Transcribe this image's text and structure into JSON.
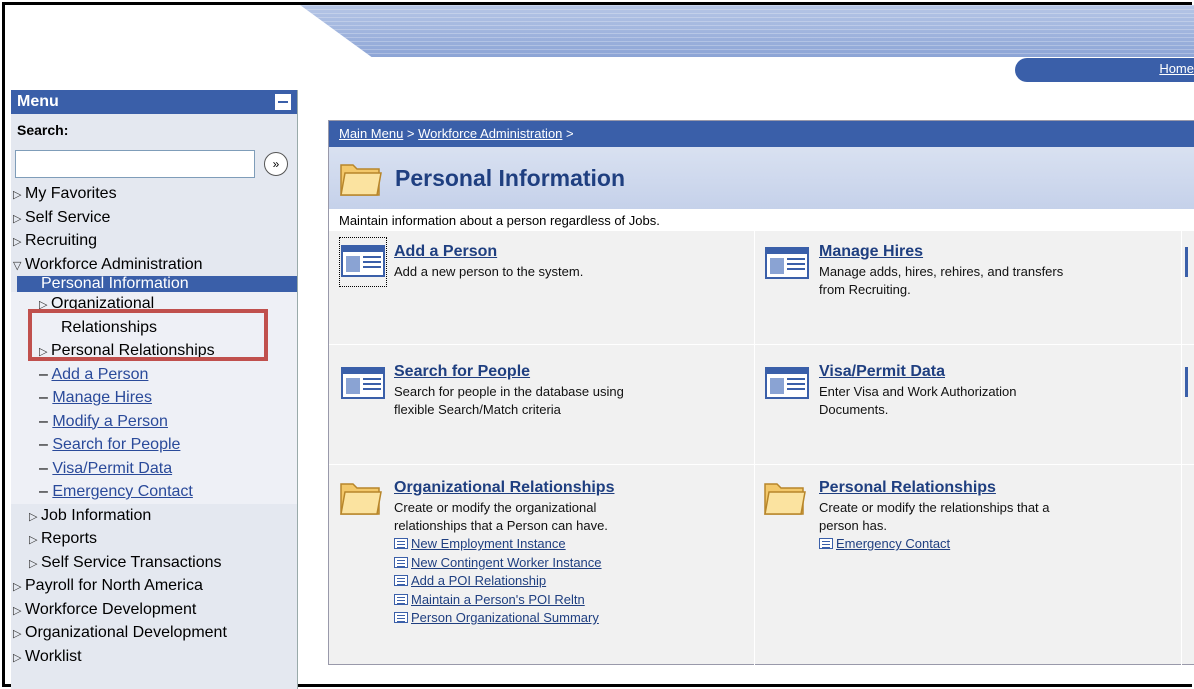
{
  "header": {
    "home_link": "Home"
  },
  "menu": {
    "title": "Menu",
    "search_label": "Search:",
    "search_value": "",
    "items": [
      {
        "label": "My Favorites"
      },
      {
        "label": "Self Service"
      },
      {
        "label": "Recruiting"
      },
      {
        "label": "Workforce Administration"
      },
      {
        "label": "Personal Information"
      },
      {
        "label": "Organizational"
      },
      {
        "label": "Relationships"
      },
      {
        "label": "Personal Relationships"
      },
      {
        "label": "Add a Person"
      },
      {
        "label": "Manage Hires"
      },
      {
        "label": "Modify a Person"
      },
      {
        "label": "Search for People"
      },
      {
        "label": "Visa/Permit Data"
      },
      {
        "label": "Emergency Contact"
      },
      {
        "label": "Job Information"
      },
      {
        "label": "Reports"
      },
      {
        "label": "Self Service Transactions"
      },
      {
        "label": "Payroll for North America"
      },
      {
        "label": "Workforce Development"
      },
      {
        "label": "Organizational Development"
      },
      {
        "label": "Worklist"
      }
    ]
  },
  "content": {
    "breadcrumb": {
      "main_menu": "Main Menu",
      "sep1": " > ",
      "workforce": "Workforce Administration",
      "sep2": " >"
    },
    "title": "Personal Information",
    "description": "Maintain information about a person regardless of Jobs.",
    "cells": {
      "add_person": {
        "title": "Add a Person",
        "desc": "Add a new person to the system."
      },
      "manage_hires": {
        "title": "Manage Hires",
        "desc1": "Manage adds, hires, rehires, and transfers",
        "desc2": "from Recruiting."
      },
      "search_people": {
        "title": "Search for People",
        "desc1": "Search for people in the database using",
        "desc2": "flexible Search/Match criteria"
      },
      "visa": {
        "title": "Visa/Permit Data",
        "desc1": "Enter Visa and Work Authorization",
        "desc2": "Documents."
      },
      "org_rel": {
        "title": "Organizational Relationships",
        "desc1": "Create or modify the organizational",
        "desc2": "relationships that a Person can have.",
        "links": [
          "New Employment Instance",
          "New Contingent Worker Instance",
          "Add a POI Relationship",
          "Maintain a Person's POI Reltn",
          "Person Organizational Summary"
        ]
      },
      "pers_rel": {
        "title": "Personal Relationships",
        "desc1": "Create or modify the relationships that a",
        "desc2": "person has.",
        "links": [
          "Emergency Contact"
        ]
      }
    }
  },
  "colors": {
    "brand": "#3a5fa9",
    "highlight": "#c0504d",
    "link": "#1f3f80"
  }
}
